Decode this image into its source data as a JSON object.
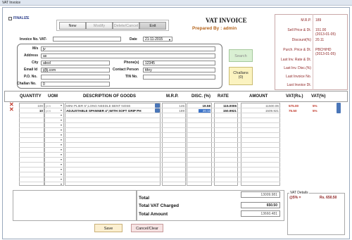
{
  "window": {
    "title": "VAT Invoice"
  },
  "finalize": {
    "label": "FINALIZE"
  },
  "toolbar": {
    "new": "New",
    "modify": "Modify",
    "delete_cancel": "Delete/Cancel",
    "exit": "Exit"
  },
  "header": {
    "title": "VAT INVOICE",
    "prepared_by": "Prepared By : admin"
  },
  "invoice": {
    "number_label": "Invoice No. VAT-",
    "number_value": "",
    "date_label": "Date",
    "date_value": "21-11-2015"
  },
  "party": {
    "ms_label": "M/s",
    "ms_value": "jv",
    "address_label": "Address",
    "address_value": "as",
    "city_label": "City",
    "city_value": "abcd",
    "phone_label": "Phone(s)",
    "phone_value": "12345",
    "email_label": "Email Id",
    "email_value": "j@j.com",
    "contact_label": "Contact Person",
    "contact_value": "tthry",
    "po_label": "P.O. No.",
    "po_value": "",
    "tin_label": "TIN No.",
    "tin_value": "",
    "challan_label": "Challan No.",
    "challan_value": "0"
  },
  "search_button": "Search",
  "challans_button": {
    "line1": "Challans",
    "line2": "(0)"
  },
  "side_info": {
    "mrp_label": "M.R.P.",
    "mrp_value": "189",
    "sell_label": "Sell Price & Dt.",
    "sell_value": "151.00",
    "sell_date": "(2013-01-05)",
    "discount_label": "Discount(%)",
    "discount_value": "20.11",
    "purch_label": "Purch. Price & Dt.",
    "purch_value": "PBCH/HD",
    "purch_date": "(2013-01-05)",
    "last_rate_label": "Last Inv. Rate & Dt.",
    "last_disc_label": "Last Inv. Disc.(%)",
    "last_inv_label": "Last Invoice No.",
    "last_inv_dt_label": "Last Invoice Dt."
  },
  "columns": [
    "QUANTITY",
    "UOM",
    "DESCRIPTION OF GOODS",
    "M.R.P.",
    "DISC. (%)",
    "RATE",
    "AMOUNT",
    "VAT(Rs.)",
    "VAT(%)"
  ],
  "rows": [
    {
      "qty": "100",
      "uom": "pcs",
      "desc": "MINI PLIER 5\",LONG NEEDLE BENT NOSE",
      "mrp": "145",
      "disc": "19.58",
      "rate": "115.0006",
      "amount": "11500.06",
      "vat_rs": "575.00",
      "vat_pct": "5%"
    },
    {
      "qty": "10",
      "uom": "pcs",
      "desc": "ADJUSTABLE SPANNER 4\",WITH SOFT GRIP PH",
      "mrp": "189",
      "disc": "20.11",
      "rate": "150.9921",
      "amount": "1509.921",
      "vat_rs": "75.50",
      "vat_pct": "5%"
    }
  ],
  "totals": {
    "total_label": "Total",
    "total_value": "13009.981",
    "vat_label": "Total VAT Charged",
    "vat_value": "650.50",
    "amount_label": "Total Amount",
    "amount_value": "13660.481"
  },
  "vat_details": {
    "title": "VAT Details",
    "rate": "@5% =",
    "amount": "Rs. 650.50"
  },
  "footer": {
    "save": "Save",
    "cancel": "Cancel/Clear"
  },
  "colors": {
    "accent_red": "#c0392b",
    "maroon": "#8b1e1e",
    "highlight": "#3b73c9",
    "green_btn": "#d9f0d3",
    "yellow_btn": "#fbf3c0"
  }
}
